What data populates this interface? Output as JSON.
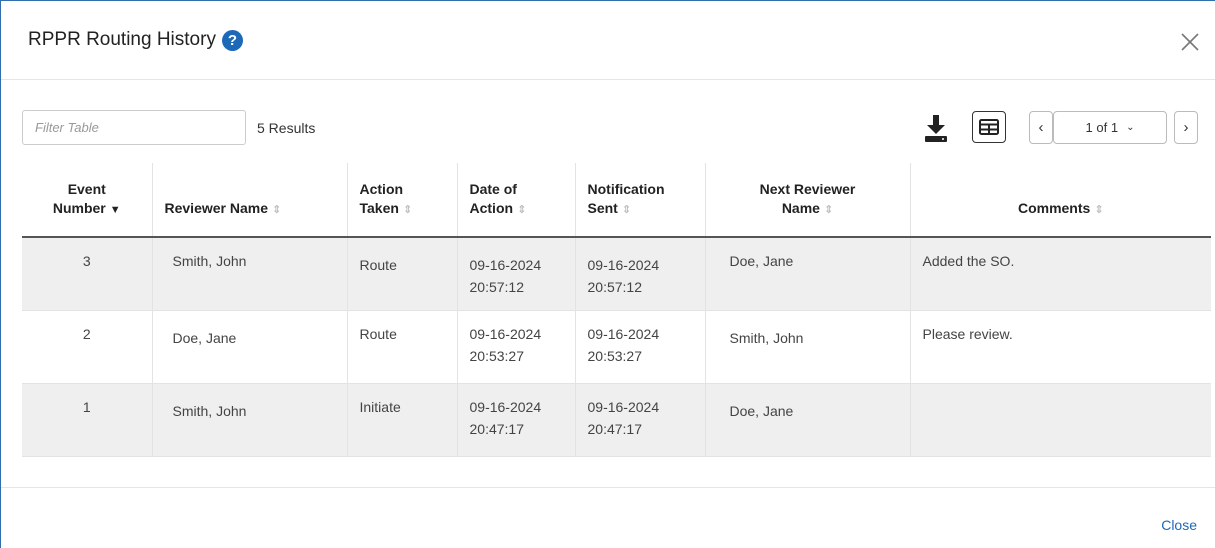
{
  "modal": {
    "title": "RPPR Routing History",
    "help_icon": "question-circle-icon",
    "close_icon": "close-icon",
    "close_label": "Close"
  },
  "toolbar": {
    "filter_placeholder": "Filter Table",
    "results": "5 Results",
    "download_icon": "download-icon",
    "columns_icon": "table-columns-icon",
    "pagination": {
      "prev": "‹",
      "next": "›",
      "current": "1 of 1"
    }
  },
  "table": {
    "headers": [
      {
        "line1": "Event",
        "line2": "Number"
      },
      {
        "line1": "",
        "line2": "Reviewer Name"
      },
      {
        "line1": "Action",
        "line2": "Taken"
      },
      {
        "line1": "Date of",
        "line2": "Action"
      },
      {
        "line1": "Notification",
        "line2": "Sent"
      },
      {
        "line1": "Next Reviewer",
        "line2": "Name"
      },
      {
        "line1": "",
        "line2": "Comments"
      }
    ],
    "rows": [
      {
        "event": "3",
        "reviewer": "Smith, John",
        "action": "Route",
        "date_action": "09-16-2024",
        "time_action": "20:57:12",
        "date_notif": "09-16-2024",
        "time_notif": "20:57:12",
        "next_reviewer": "Doe, Jane",
        "comments": "Added the SO."
      },
      {
        "event": "2",
        "reviewer": "Doe, Jane",
        "action": "Route",
        "date_action": "09-16-2024",
        "time_action": "20:53:27",
        "date_notif": "09-16-2024",
        "time_notif": "20:53:27",
        "next_reviewer": "Smith, John",
        "comments": "Please review."
      },
      {
        "event": "1",
        "reviewer": "Smith, John",
        "action": "Initiate",
        "date_action": "09-16-2024",
        "time_action": "20:47:17",
        "date_notif": "09-16-2024",
        "time_notif": "20:47:17",
        "next_reviewer": "Doe, Jane",
        "comments": ""
      }
    ]
  }
}
